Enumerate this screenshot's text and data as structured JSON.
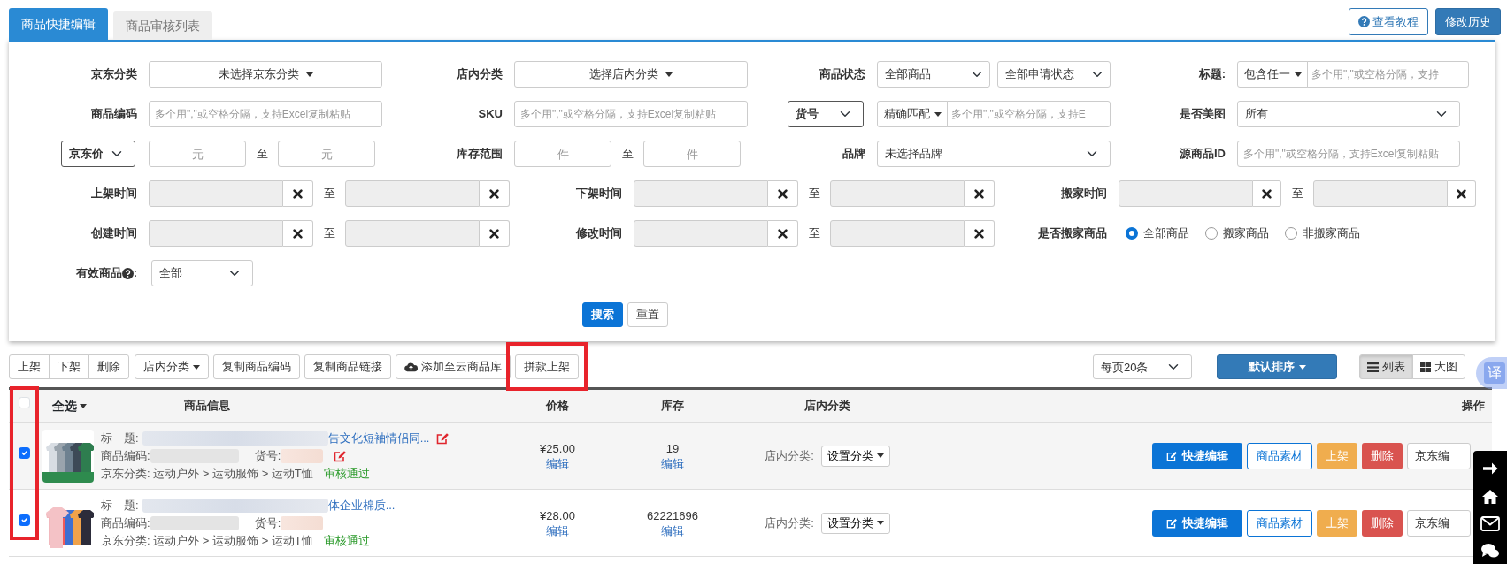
{
  "tabs": [
    {
      "label": "商品快捷编辑",
      "selected": true
    },
    {
      "label": "商品审核列表",
      "selected": false
    }
  ],
  "header_buttons": [
    {
      "label": "查看教程",
      "kind": "help"
    },
    {
      "label": "修改历史",
      "kind": "solid"
    }
  ],
  "filters": [
    {
      "fields": [
        {
          "kind": "dropdown",
          "label": "京东分类",
          "value": "未选择京东分类"
        },
        {
          "kind": "dropdown",
          "label": "店内分类",
          "value": "选择店内分类"
        },
        {
          "kind": "select_pair",
          "label": "商品状态",
          "values": [
            "全部商品",
            "全部申请状态"
          ]
        },
        {
          "kind": "addon_input",
          "label": "标题:",
          "addon": "包含任一",
          "placeholder": "多个用\",\"或空格分隔，支持"
        }
      ]
    },
    {
      "fields": [
        {
          "kind": "input",
          "label": "商品编码",
          "placeholder": "多个用\",\"或空格分隔，支持Excel复制粘贴"
        },
        {
          "kind": "input",
          "label": "SKU",
          "placeholder": "多个用\",\"或空格分隔，支持Excel复制粘贴"
        },
        {
          "kind": "addon_input",
          "label_select": "货号",
          "addon": "精确匹配",
          "placeholder": "多个用\",\"或空格分隔，支持E"
        },
        {
          "kind": "select",
          "label": "是否美图",
          "value": "所有"
        }
      ]
    },
    {
      "fields": [
        {
          "kind": "range",
          "label_select": "京东价",
          "placeholders": [
            "元",
            "元"
          ],
          "separator": "至"
        },
        {
          "kind": "range",
          "label": "库存范围",
          "placeholders": [
            "件",
            "件"
          ],
          "separator": "至"
        },
        {
          "kind": "select",
          "label": "品牌",
          "value": "未选择品牌"
        },
        {
          "kind": "input",
          "label": "源商品ID",
          "placeholder": "多个用\",\"或空格分隔，支持Excel复制粘贴"
        }
      ]
    },
    {
      "fields": [
        {
          "kind": "date_range",
          "label": "上架时间",
          "separator": "至"
        },
        {
          "kind": "date_range",
          "label": "下架时间",
          "separator": "至"
        },
        {
          "kind": "date_range",
          "label": "搬家时间",
          "separator": "至"
        }
      ]
    },
    {
      "fields": [
        {
          "kind": "date_range",
          "label": "创建时间",
          "separator": "至"
        },
        {
          "kind": "date_range",
          "label": "修改时间",
          "separator": "至"
        },
        {
          "kind": "radio",
          "label": "是否搬家商品",
          "options": [
            {
              "label": "全部商品",
              "selected": true
            },
            {
              "label": "搬家商品",
              "selected": false
            },
            {
              "label": "非搬家商品",
              "selected": false
            }
          ]
        }
      ]
    },
    {
      "fields": [
        {
          "kind": "select",
          "label": "有效商品",
          "help": true,
          "label_suffix": ":",
          "value": "全部"
        }
      ]
    }
  ],
  "filter_actions": [
    {
      "label": "搜索",
      "kind": "primary"
    },
    {
      "label": "重置",
      "kind": "default"
    }
  ],
  "toolbar": [
    [
      {
        "label": "上架",
        "kind": "plain"
      },
      {
        "label": "下架",
        "kind": "plain"
      },
      {
        "label": "删除",
        "kind": "plain"
      }
    ],
    [
      {
        "label": "店内分类",
        "kind": "dropdown"
      }
    ],
    [
      {
        "label": "复制商品编码",
        "kind": "plain"
      }
    ],
    [
      {
        "label": "复制商品链接",
        "kind": "plain"
      }
    ],
    [
      {
        "label": "添加至云商品库",
        "kind": "cloud"
      }
    ],
    [
      {
        "label": "拼款上架",
        "kind": "plain",
        "highlighted": true
      }
    ]
  ],
  "page_size": "每页20条",
  "sort": "默认排序",
  "views": [
    {
      "label": "列表",
      "kind": "list",
      "selected": true
    },
    {
      "label": "大图",
      "kind": "grid",
      "selected": false
    }
  ],
  "translate_badge": "译",
  "table": {
    "select_all": {
      "label": "全选",
      "checked": false,
      "highlighted": true
    },
    "columns": [
      "商品信息",
      "价格",
      "库存",
      "店内分类",
      "操作"
    ],
    "rows": [
      {
        "checked": true,
        "title_label": "标　题:",
        "title_blurred": true,
        "title": "告文化短袖情侣同...",
        "title_editable": true,
        "code_label": "商品编码:",
        "code_blurred": true,
        "sku_label": "货号:",
        "sku_blurred": true,
        "sku_editable": true,
        "category": "京东分类: 运动户外 > 运动服饰 > 运动T恤",
        "status": "审核通过",
        "price": "¥25.00",
        "price_edit": "编辑",
        "stock": "19",
        "stock_edit": "编辑",
        "shop_category_label": "店内分类:",
        "shop_category": "设置分类",
        "actions": [
          {
            "label": "快捷编辑",
            "kind": "primary"
          },
          {
            "label": "商品素材",
            "kind": "outline"
          },
          {
            "label": "上架",
            "kind": "warning"
          },
          {
            "label": "删除",
            "kind": "danger"
          },
          {
            "label": "京东编",
            "kind": "default"
          }
        ]
      },
      {
        "checked": true,
        "title_label": "标　题:",
        "title_blurred": true,
        "title": "体企业棉质...",
        "title_editable": false,
        "code_label": "商品编码:",
        "code_blurred": true,
        "sku_label": "货号:",
        "sku_blurred": true,
        "sku_editable": false,
        "category": "京东分类: 运动户外 > 运动服饰 > 运动T恤",
        "status": "审核通过",
        "price": "¥28.00",
        "price_edit": "编辑",
        "stock": "62221696",
        "stock_edit": "编辑",
        "shop_category_label": "店内分类:",
        "shop_category": "设置分类",
        "actions": [
          {
            "label": "快捷编辑",
            "kind": "primary"
          },
          {
            "label": "商品素材",
            "kind": "outline"
          },
          {
            "label": "上架",
            "kind": "warning"
          },
          {
            "label": "删除",
            "kind": "danger"
          },
          {
            "label": "京东编",
            "kind": "default"
          }
        ]
      }
    ]
  }
}
